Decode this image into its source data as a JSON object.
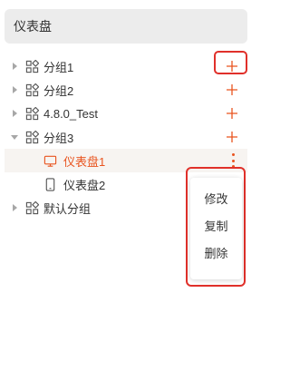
{
  "header": {
    "title": "仪表盘"
  },
  "tree": {
    "groups": [
      {
        "label": "分组1",
        "state": "collapsed",
        "has_add": true,
        "highlighted_add": true
      },
      {
        "label": "分组2",
        "state": "collapsed",
        "has_add": true
      },
      {
        "label": "4.8.0_Test",
        "state": "collapsed",
        "has_add": true
      },
      {
        "label": "分组3",
        "state": "expanded",
        "has_add": true,
        "children": [
          {
            "label": "仪表盘1",
            "icon": "monitor-icon",
            "selected": true
          },
          {
            "label": "仪表盘2",
            "icon": "phone-icon",
            "selected": false
          }
        ]
      },
      {
        "label": "默认分组",
        "state": "collapsed",
        "has_add": false
      }
    ]
  },
  "context_menu": {
    "items": [
      "修改",
      "复制",
      "删除"
    ]
  },
  "colors": {
    "accent": "#e9541f",
    "highlight_border": "#e0302a",
    "header_bg": "#ececec"
  }
}
